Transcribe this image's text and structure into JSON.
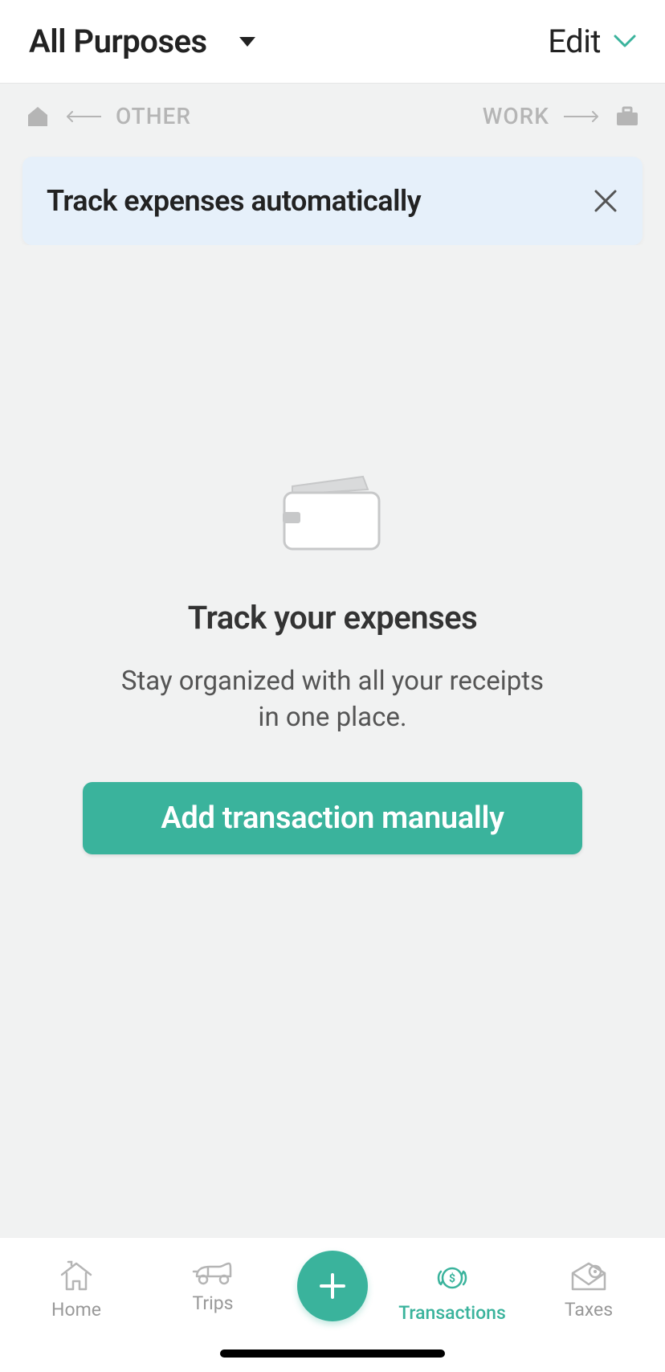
{
  "header": {
    "filter_label": "All Purposes",
    "edit_label": "Edit"
  },
  "category_bar": {
    "left_label": "OTHER",
    "right_label": "WORK"
  },
  "banner": {
    "title": "Track expenses automatically"
  },
  "empty_state": {
    "title": "Track your expenses",
    "subtitle": "Stay organized with all your receipts in one place.",
    "cta_label": "Add transaction manually"
  },
  "bottom_nav": {
    "items": [
      {
        "label": "Home"
      },
      {
        "label": "Trips"
      },
      {
        "label": "Transactions"
      },
      {
        "label": "Taxes"
      }
    ]
  },
  "colors": {
    "accent": "#3ab39c",
    "banner_bg": "#e6f0fa"
  }
}
